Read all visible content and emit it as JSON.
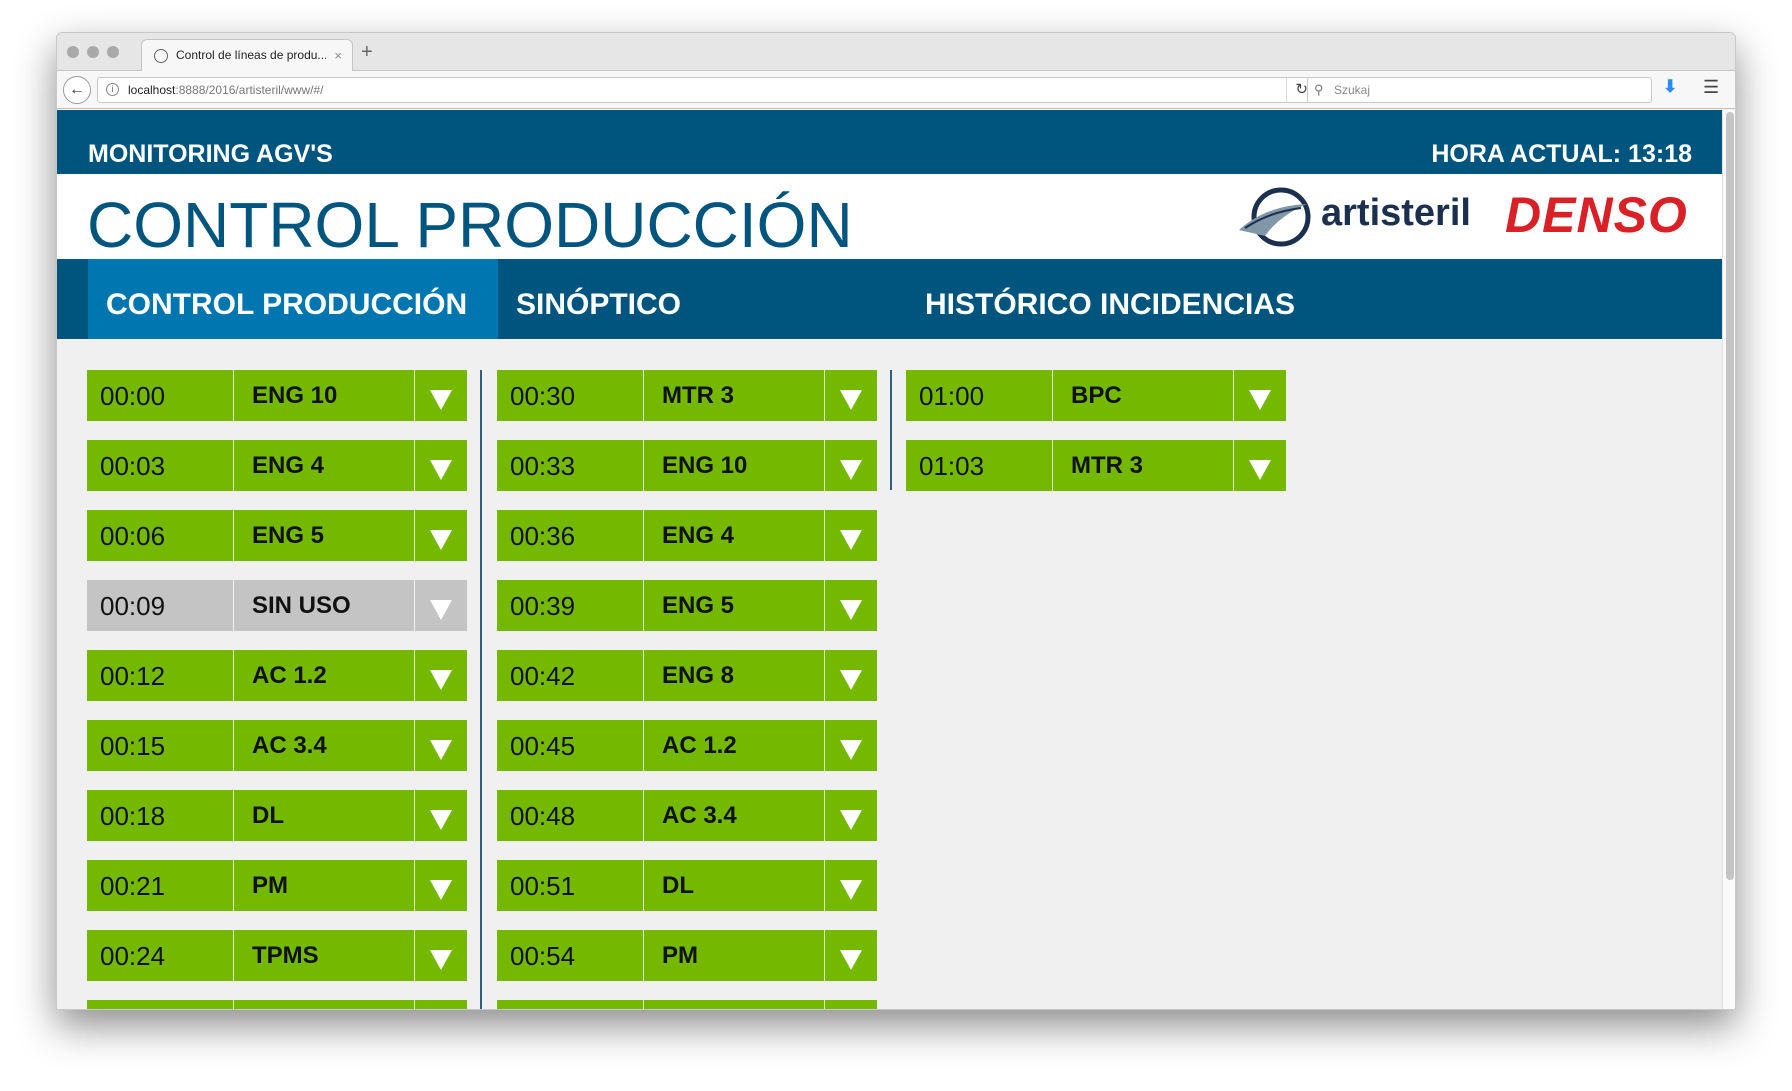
{
  "browser": {
    "tab_title": "Control de líneas de produ...",
    "tab_close": "×",
    "new_tab": "+",
    "url_host": "localhost",
    "url_rest": ":8888/2016/artisteril/www/#/",
    "search_placeholder": "Szukaj"
  },
  "topbar": {
    "left": "MONITORING AGV'S",
    "right": "HORA ACTUAL: 13:18"
  },
  "header": {
    "title": "CONTROL PRODUCCIÓN",
    "logo_text": "artisteril",
    "brand_text": "DENSO"
  },
  "tabs": [
    {
      "label": "CONTROL PRODUCCIÓN",
      "active": true
    },
    {
      "label": "SINÓPTICO",
      "active": false
    },
    {
      "label": "HISTÓRICO INCIDENCIAS",
      "active": false
    }
  ],
  "columns": [
    [
      {
        "time": "00:00",
        "name": "ENG 10",
        "status": "active"
      },
      {
        "time": "00:03",
        "name": "ENG 4",
        "status": "active"
      },
      {
        "time": "00:06",
        "name": "ENG 5",
        "status": "active"
      },
      {
        "time": "00:09",
        "name": "SIN USO",
        "status": "unused"
      },
      {
        "time": "00:12",
        "name": "AC 1.2",
        "status": "active"
      },
      {
        "time": "00:15",
        "name": "AC 3.4",
        "status": "active"
      },
      {
        "time": "00:18",
        "name": "DL",
        "status": "active"
      },
      {
        "time": "00:21",
        "name": "PM",
        "status": "active"
      },
      {
        "time": "00:24",
        "name": "TPMS",
        "status": "active"
      },
      {
        "time": "",
        "name": "",
        "status": "active"
      }
    ],
    [
      {
        "time": "00:30",
        "name": "MTR 3",
        "status": "active"
      },
      {
        "time": "00:33",
        "name": "ENG 10",
        "status": "active"
      },
      {
        "time": "00:36",
        "name": "ENG 4",
        "status": "active"
      },
      {
        "time": "00:39",
        "name": "ENG 5",
        "status": "active"
      },
      {
        "time": "00:42",
        "name": "ENG 8",
        "status": "active"
      },
      {
        "time": "00:45",
        "name": "AC 1.2",
        "status": "active"
      },
      {
        "time": "00:48",
        "name": "AC 3.4",
        "status": "active"
      },
      {
        "time": "00:51",
        "name": "DL",
        "status": "active"
      },
      {
        "time": "00:54",
        "name": "PM",
        "status": "active"
      },
      {
        "time": "",
        "name": "",
        "status": "active"
      }
    ],
    [
      {
        "time": "01:00",
        "name": "BPC",
        "status": "active"
      },
      {
        "time": "01:03",
        "name": "MTR 3",
        "status": "active"
      }
    ]
  ],
  "colors": {
    "primary": "#00557e",
    "active_tab": "#0076b0",
    "row_active": "#74b900",
    "row_unused": "#c4c4c4",
    "brand_red": "#d92027"
  }
}
